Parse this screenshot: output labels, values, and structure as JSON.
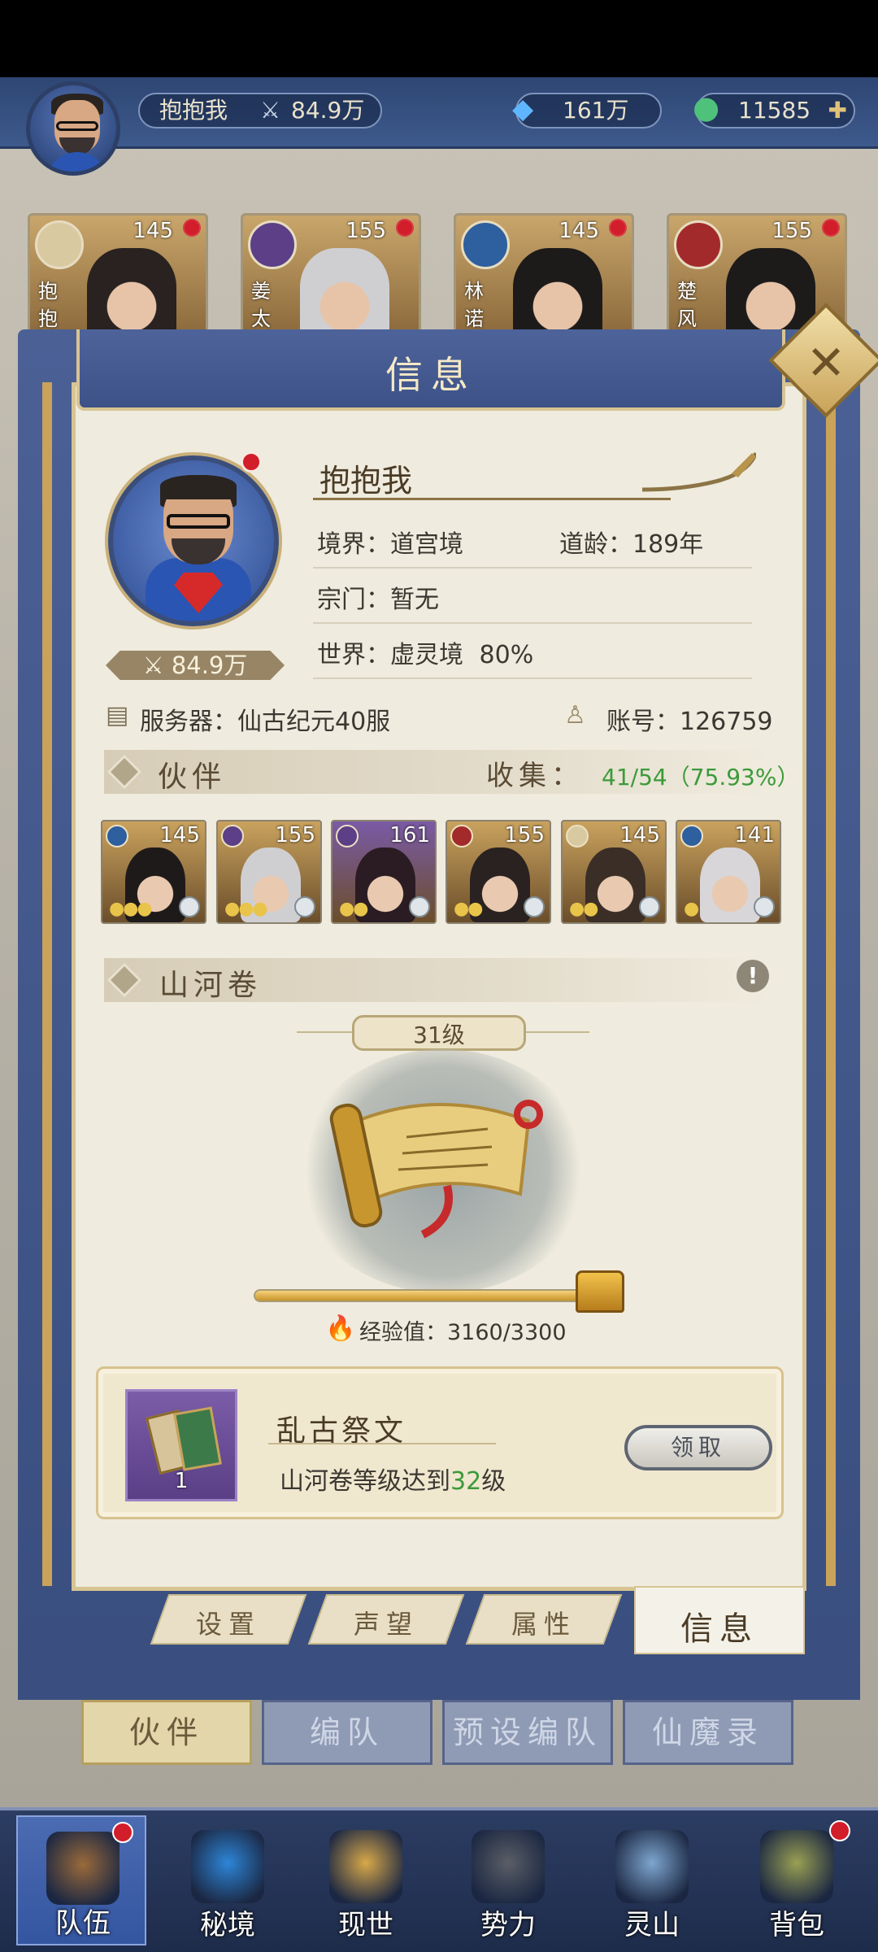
{
  "topbar": {
    "player_name": "抱抱我",
    "power": "84.9万",
    "jade": "161万",
    "coins": "11585"
  },
  "hero_cards": [
    {
      "level": "145",
      "name": "抱抱",
      "element_color": "#d9c9a1",
      "face_color": "#2a2220"
    },
    {
      "level": "155",
      "name": "姜太",
      "element_color": "#5c3f86",
      "face_color": "#cfcfd2"
    },
    {
      "level": "145",
      "name": "林诺",
      "element_color": "#2e5f9e",
      "face_color": "#1d1a1a"
    },
    {
      "level": "155",
      "name": "楚风",
      "element_color": "#a32a2a",
      "face_color": "#1d1a1a"
    }
  ],
  "panel": {
    "title": "信息",
    "close_icon": "close-x"
  },
  "profile": {
    "name": "抱抱我",
    "power": "84.9万",
    "realm": "境界：道宫境",
    "age": "道龄：189年",
    "sect": "宗门：暂无",
    "world": "世界：虚灵境",
    "world_pct": "80%",
    "server": "服务器：仙古纪元40服",
    "account": "账号：126759"
  },
  "partners": {
    "title": "伙伴",
    "collect_label": "收集：",
    "collect_value": "41/54（75.93%）",
    "cards": [
      {
        "level": "145",
        "element": "#2e5f9e",
        "bg": "#c9a25e",
        "face": "#1f1a1a",
        "dots": "●●●"
      },
      {
        "level": "155",
        "element": "#5c3f86",
        "bg": "#c9a25e",
        "face": "#cfcfd2",
        "dots": "●●●"
      },
      {
        "level": "161",
        "element": "#5c3f86",
        "bg": "#7a5aa5",
        "face": "#2a1c22",
        "dots": "●●"
      },
      {
        "level": "155",
        "element": "#a32a2a",
        "bg": "#c9a25e",
        "face": "#2a2220",
        "dots": "●●"
      },
      {
        "level": "145",
        "element": "#d9c9a1",
        "bg": "#c9a25e",
        "face": "#3a2e26",
        "dots": "●●"
      },
      {
        "level": "141",
        "element": "#2e5f9e",
        "bg": "#c9a25e",
        "face": "#d8d6d8",
        "dots": "●"
      }
    ]
  },
  "scroll": {
    "title": "山河卷",
    "level": "31级",
    "exp_label": "经验值：3160/3300",
    "exp_fraction": 0.9576
  },
  "reward": {
    "name": "乱古祭文",
    "desc_prefix": "山河卷等级达到",
    "desc_level": "32",
    "desc_suffix": "级",
    "count": "1",
    "claim": "领取"
  },
  "panel_tabs": [
    "设置",
    "声望",
    "属性",
    "信息"
  ],
  "sub_tabs": [
    "伙伴",
    "编队",
    "预设编队",
    "仙魔录"
  ],
  "nav": [
    {
      "label": "队伍",
      "color": "#9a6a3b",
      "dot": true,
      "active": true
    },
    {
      "label": "秘境",
      "color": "#2d86d8",
      "dot": false,
      "active": false
    },
    {
      "label": "现世",
      "color": "#d8a84a",
      "dot": false,
      "active": false
    },
    {
      "label": "势力",
      "color": "#5a5e66",
      "dot": false,
      "active": false
    },
    {
      "label": "灵山",
      "color": "#7ea6cf",
      "dot": false,
      "active": false
    },
    {
      "label": "背包",
      "color": "#9aa053",
      "dot": true,
      "active": false
    }
  ]
}
